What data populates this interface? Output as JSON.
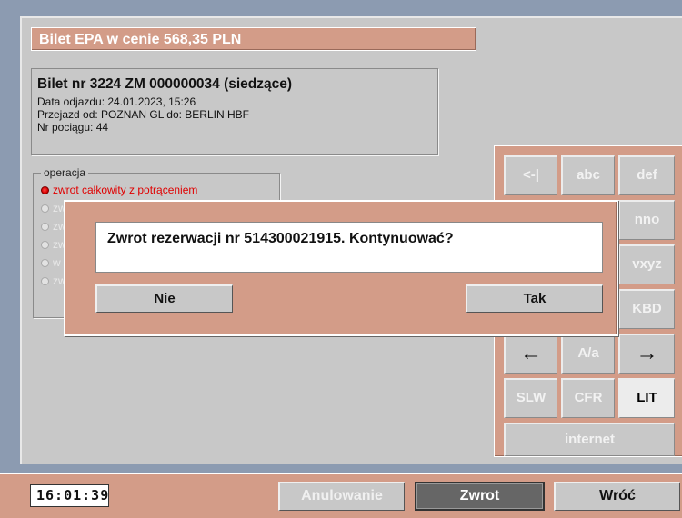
{
  "header": {
    "title": "Bilet EPA w cenie 568,35 PLN"
  },
  "ticket": {
    "title": "Bilet nr 3224 ZM 000000034 (siedzące)",
    "departure": "Data odjazdu: 24.01.2023, 15:26",
    "route": "Przejazd od: POZNAN GL do: BERLIN HBF",
    "train": "Nr pociągu: 44"
  },
  "operation": {
    "legend": "operacja",
    "items": [
      {
        "label": "zwrot całkowity z potrąceniem",
        "selected": true
      },
      {
        "label": "zw",
        "selected": false
      },
      {
        "label": "zw",
        "selected": false
      },
      {
        "label": "zw",
        "selected": false
      },
      {
        "label": "w",
        "selected": false
      },
      {
        "label": "zw",
        "selected": false
      }
    ]
  },
  "keypad": {
    "keys": [
      "<-|",
      "abc",
      "def",
      "",
      "",
      "nno",
      "",
      "",
      "vxyz",
      "",
      "",
      "KBD",
      "←",
      "A/a",
      "→",
      "SLW",
      "CFR",
      "LIT",
      "internet"
    ]
  },
  "dialog": {
    "message": "Zwrot rezerwacji nr 514300021915. Kontynuować?",
    "no_label": "Nie",
    "yes_label": "Tak"
  },
  "bottom": {
    "clock": "16:01:39",
    "cancel_label": "Anulowanie",
    "refund_label": "Zwrot",
    "back_label": "Wróć"
  },
  "colors": {
    "accent": "#d39c88",
    "panel": "#c8c8c8",
    "background": "#8c9bb1",
    "selected_radio": "#e00000"
  }
}
